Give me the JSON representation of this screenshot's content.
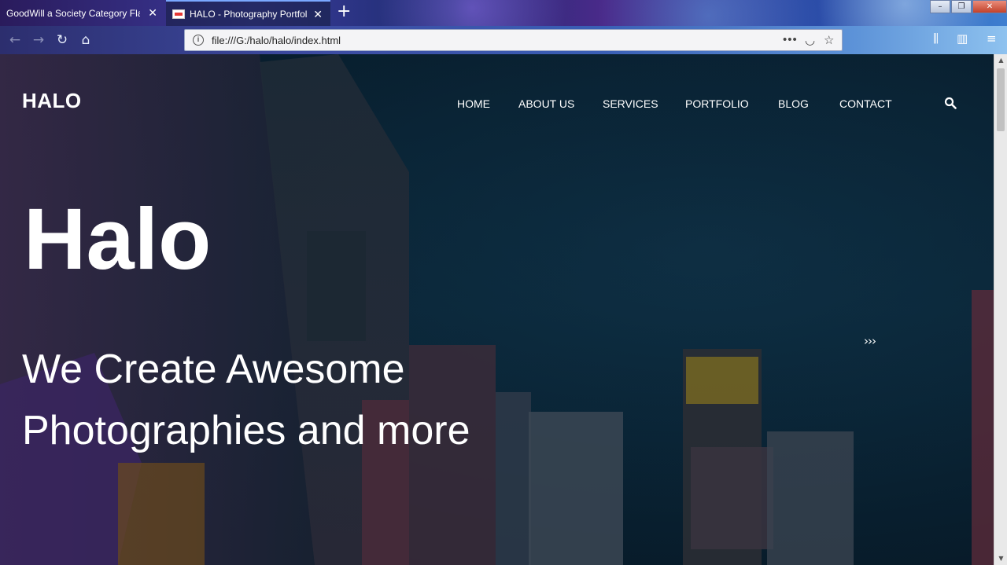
{
  "browser": {
    "tabs": [
      {
        "title": "GoodWill a Society Category Flat Bootstrap",
        "active": false
      },
      {
        "title": "HALO - Photography Portfolio",
        "active": true
      }
    ],
    "new_tab": "+",
    "close_glyph": "✕",
    "url": "file:///G:/halo/halo/index.html",
    "page_actions": [
      "more-icon",
      "pocket-icon",
      "bookmark-star-icon"
    ],
    "toolbar_icons": [
      "library-icon",
      "sidebar-icon",
      "menu-icon"
    ],
    "accent": "#7aa8ff"
  },
  "site": {
    "logo": "HALO",
    "nav": [
      {
        "label": "HOME"
      },
      {
        "label": "ABOUT US"
      },
      {
        "label": "SERVICES"
      },
      {
        "label": "PORTFOLIO"
      },
      {
        "label": "BLOG"
      },
      {
        "label": "CONTACT"
      }
    ],
    "search_icon": "search-icon",
    "hero": {
      "title": "Halo",
      "subtitle": "We Create Awesome Photographies and more",
      "next_arrows": "›››"
    }
  }
}
